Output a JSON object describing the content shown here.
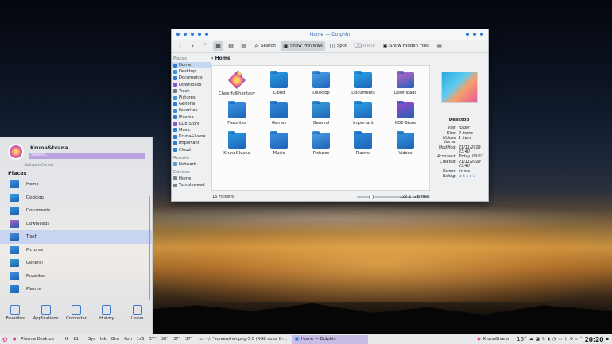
{
  "dolphin": {
    "title": "Home — Dolphin",
    "toolbar": {
      "search": "Search",
      "show_previews": "Show Previews",
      "split": "Split",
      "delete": "Delete",
      "show_hidden": "Show Hidden Files"
    },
    "breadcrumb": "Home",
    "places_header": "Places",
    "places": [
      "Home",
      "Desktop",
      "Documents",
      "Downloads",
      "Trash",
      "Pictures",
      "General",
      "Favorites",
      "Plasma",
      "KDE-Store",
      "Music",
      "Kruna&Ivana",
      "Important",
      "Cloud"
    ],
    "remote_header": "Remote",
    "remote": [
      "Network"
    ],
    "devices_header": "Devices",
    "devices": [
      "Home",
      "Tumbleweed"
    ],
    "items": [
      {
        "name": "CheerfulPhantasy",
        "color": "#e86fa3"
      },
      {
        "name": "Cloud",
        "color": "#2a9ee3"
      },
      {
        "name": "Desktop",
        "color": "#4aa3e8"
      },
      {
        "name": "Documents",
        "color": "#27a6e6"
      },
      {
        "name": "Downloads",
        "color": "#c660c8"
      },
      {
        "name": "Favorites",
        "color": "#3b98e4"
      },
      {
        "name": "Games",
        "color": "#2f8bd8"
      },
      {
        "name": "General",
        "color": "#3aa0d6"
      },
      {
        "name": "Important",
        "color": "#29a0e3"
      },
      {
        "name": "KDE-Store",
        "color": "#9b49c6"
      },
      {
        "name": "Kruna&Ivana",
        "color": "#2b9ae0"
      },
      {
        "name": "Music",
        "color": "#3a8ee0"
      },
      {
        "name": "Pictures",
        "color": "#4ba0e4"
      },
      {
        "name": "Plasma",
        "color": "#2a8bd8"
      },
      {
        "name": "Videos",
        "color": "#3594e0"
      }
    ],
    "status": "15 Folders",
    "free": "122.1 GiB free",
    "info": {
      "name": "Desktop",
      "rows": [
        {
          "k": "Type:",
          "v": "folder"
        },
        {
          "k": "Size:",
          "v": "2 items"
        },
        {
          "k": "Hidden items:",
          "v": "1 item"
        },
        {
          "k": "Modified:",
          "v": "21/11/2019 23:40"
        },
        {
          "k": "Accessed:",
          "v": "Today, 09:07"
        },
        {
          "k": "Created:",
          "v": "21/11/2019 23:40"
        },
        {
          "k": "Owner:",
          "v": "kruna"
        },
        {
          "k": "Rating:",
          "v": "★★★★★"
        }
      ]
    }
  },
  "launcher": {
    "user": "Kruna&Ivana",
    "search_placeholder": "Search...",
    "scrolled_item": "Software Center",
    "section": "Places",
    "items": [
      {
        "label": "Home",
        "color": "#3c8fe0"
      },
      {
        "label": "Desktop",
        "color": "#3aa3e3"
      },
      {
        "label": "Documents",
        "color": "#2c94de"
      },
      {
        "label": "Downloads",
        "color": "#b55fc9"
      },
      {
        "label": "Trash",
        "color": "#4c8fd8"
      },
      {
        "label": "Pictures",
        "color": "#3a96e0"
      },
      {
        "label": "General",
        "color": "#3a9fd4"
      },
      {
        "label": "Favorites",
        "color": "#3c93e2"
      },
      {
        "label": "Plasma",
        "color": "#2b8ed9"
      }
    ],
    "tabs": [
      "Favorites",
      "Applications",
      "Computer",
      "History",
      "Leave"
    ]
  },
  "panel": {
    "desktop": "Plasma Desktop",
    "desktops": [
      "Ik",
      "k1"
    ],
    "widgets": [
      "Sys",
      "Ink",
      "Gim",
      "Kon",
      "1x5"
    ],
    "temps": [
      "37°",
      "38°",
      "37°",
      "37°"
    ],
    "tasks": [
      "~/. *screenshot.png-5.0 (RGB color 8-...",
      "Home — Dolphin"
    ],
    "user": "Kruna&Ivana",
    "temp": "15°",
    "clock": "20:20"
  }
}
